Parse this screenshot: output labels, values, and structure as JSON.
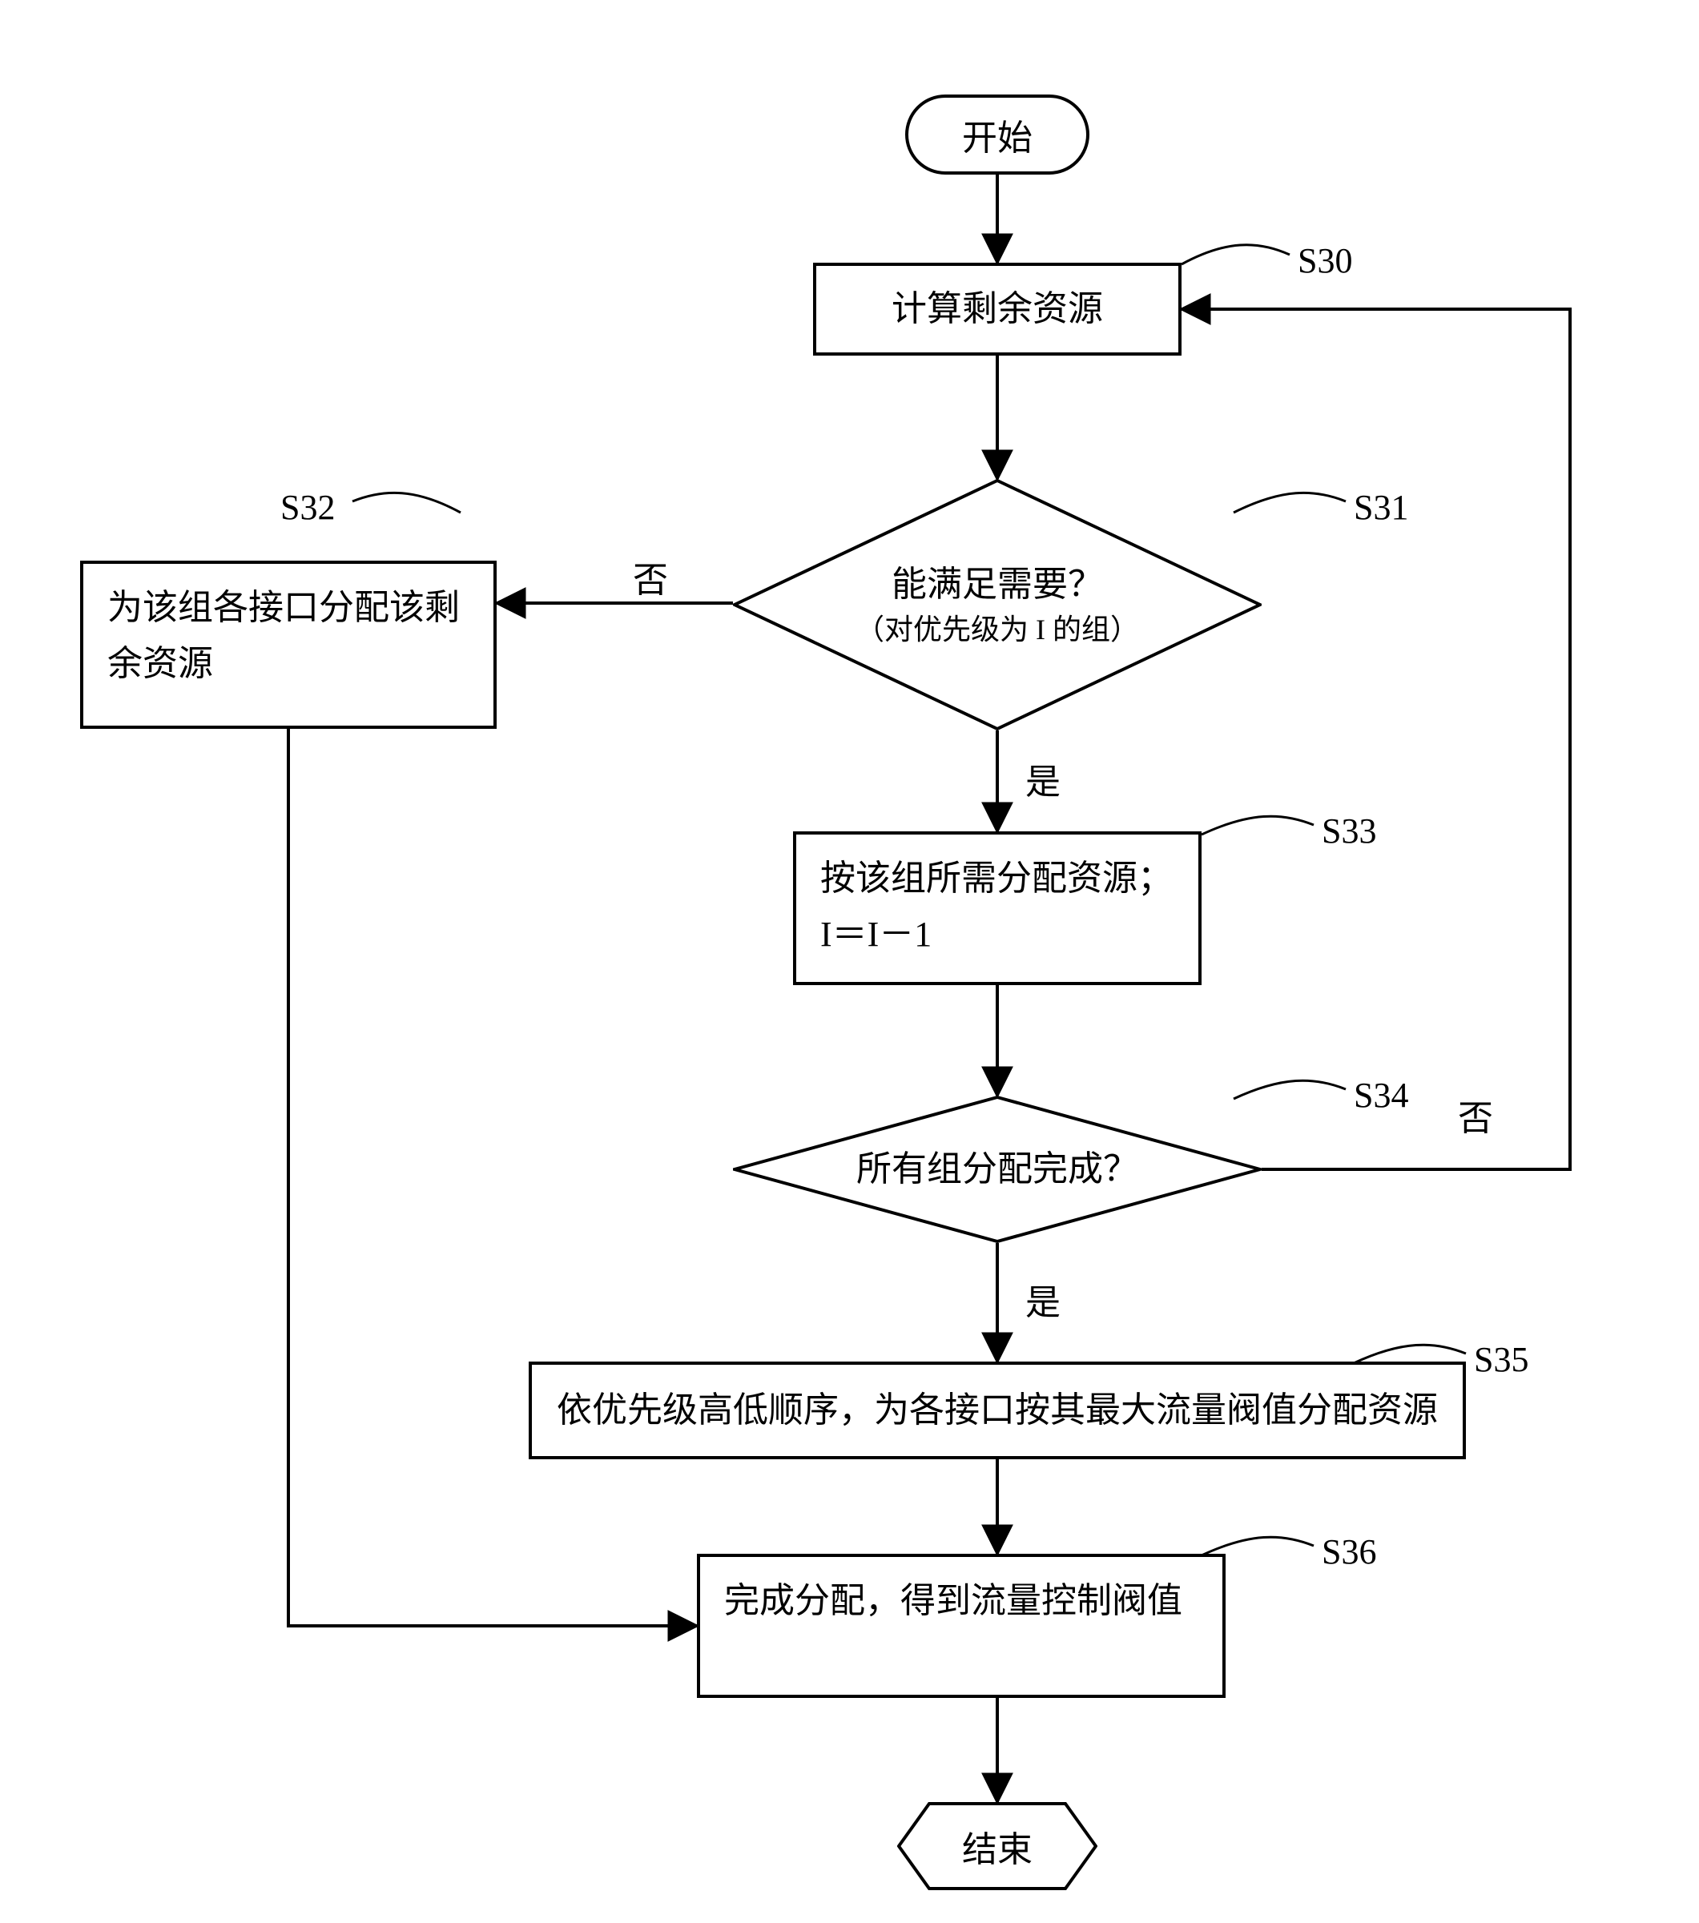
{
  "terminator_start": "开始",
  "terminator_end": "结束",
  "s30": {
    "id": "S30",
    "text": "计算剩余资源"
  },
  "s31": {
    "id": "S31",
    "main": "能满足需要？",
    "sub": "（对优先级为 I 的组）"
  },
  "s32": {
    "id": "S32",
    "text": "为该组各接口分配该剩余资源"
  },
  "s33": {
    "id": "S33",
    "line1": "按该组所需分配资源；",
    "line2": "I＝I－1"
  },
  "s34": {
    "id": "S34",
    "text": "所有组分配完成？"
  },
  "s35": {
    "id": "S35",
    "text": "依优先级高低顺序，为各接口按其最大流量阀值分配资源"
  },
  "s36": {
    "id": "S36",
    "text": "完成分配，得到流量控制阀值"
  },
  "labels": {
    "yes": "是",
    "no": "否"
  },
  "chart_data": {
    "type": "flowchart",
    "nodes": [
      {
        "id": "start",
        "type": "terminator",
        "text": "开始"
      },
      {
        "id": "S30",
        "type": "process",
        "text": "计算剩余资源"
      },
      {
        "id": "S31",
        "type": "decision",
        "text": "能满足需要？（对优先级为 I 的组）"
      },
      {
        "id": "S32",
        "type": "process",
        "text": "为该组各接口分配该剩余资源"
      },
      {
        "id": "S33",
        "type": "process",
        "text": "按该组所需分配资源；I＝I－1"
      },
      {
        "id": "S34",
        "type": "decision",
        "text": "所有组分配完成？"
      },
      {
        "id": "S35",
        "type": "process",
        "text": "依优先级高低顺序，为各接口按其最大流量阀值分配资源"
      },
      {
        "id": "S36",
        "type": "process",
        "text": "完成分配，得到流量控制阀值"
      },
      {
        "id": "end",
        "type": "terminator",
        "text": "结束"
      }
    ],
    "edges": [
      {
        "from": "start",
        "to": "S30"
      },
      {
        "from": "S30",
        "to": "S31"
      },
      {
        "from": "S31",
        "to": "S33",
        "label": "是"
      },
      {
        "from": "S31",
        "to": "S32",
        "label": "否"
      },
      {
        "from": "S33",
        "to": "S34"
      },
      {
        "from": "S34",
        "to": "S35",
        "label": "是"
      },
      {
        "from": "S34",
        "to": "S30",
        "label": "否"
      },
      {
        "from": "S35",
        "to": "S36"
      },
      {
        "from": "S32",
        "to": "S36"
      },
      {
        "from": "S36",
        "to": "end"
      }
    ]
  }
}
